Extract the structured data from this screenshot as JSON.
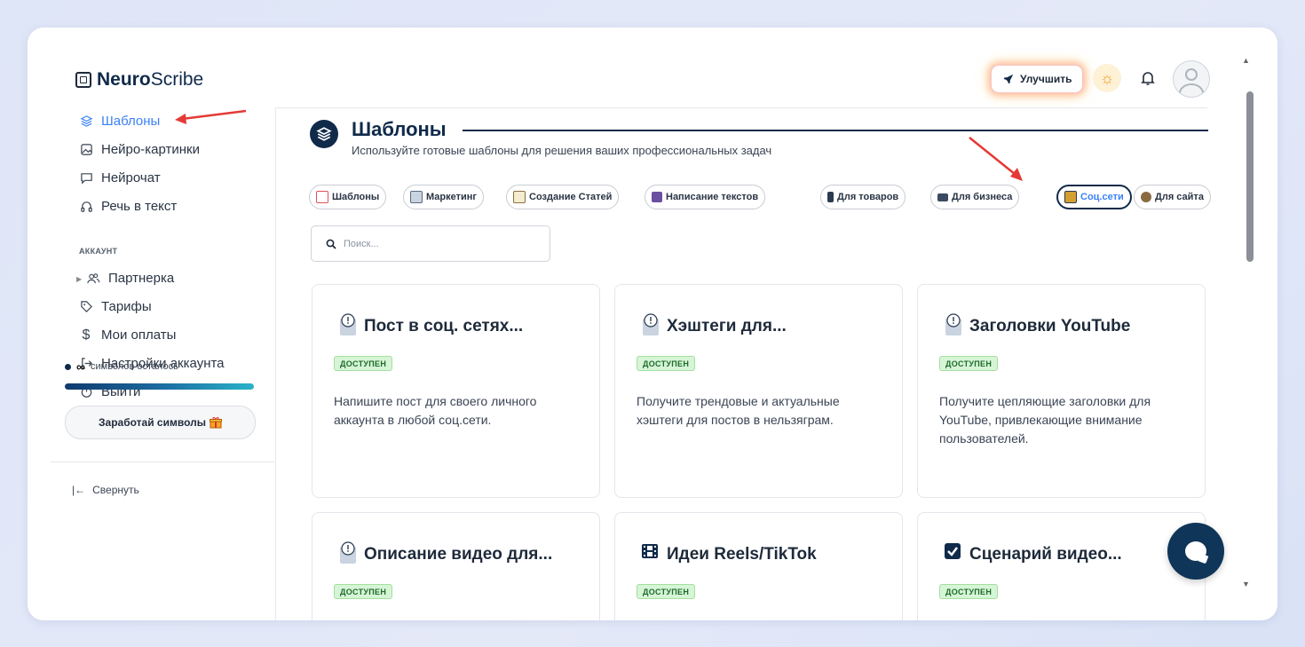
{
  "app": {
    "logo_bold": "Neuro",
    "logo_regular": "Scribe"
  },
  "header": {
    "upgrade_label": "Улучшить",
    "theme_icon": "sun-icon",
    "notifications_icon": "bell-icon",
    "avatar_icon": "user-avatar-icon"
  },
  "sidebar": {
    "items": [
      {
        "label": "Шаблоны",
        "icon": "layers-icon",
        "active": true
      },
      {
        "label": "Нейро-картинки",
        "icon": "image-icon"
      },
      {
        "label": "Нейрочат",
        "icon": "chat-icon"
      },
      {
        "label": "Речь в текст",
        "icon": "headphones-icon"
      }
    ],
    "account_label": "АККАУНТ",
    "account_items": [
      {
        "label": "Партнерка",
        "icon": "users-icon"
      },
      {
        "label": "Тарифы",
        "icon": "tag-icon"
      },
      {
        "label": "Мои оплаты",
        "icon": "dollar-icon"
      },
      {
        "label": "Настройки аккаунта",
        "icon": "login-icon"
      },
      {
        "label": "Выйти",
        "icon": "power-icon"
      }
    ],
    "chars_infinity": "∞",
    "chars_label": "символов осталось",
    "earn_label": "Заработай символы",
    "collapse_label": "Свернуть"
  },
  "main": {
    "title": "Шаблоны",
    "subtitle": "Используйте готовые шаблоны для решения ваших профессиональных задач",
    "search_placeholder": "Поиск...",
    "chips": [
      {
        "label": "Шаблоны",
        "color": "#e0505a"
      },
      {
        "label": "Маркетинг",
        "color": "#8aa0b8"
      },
      {
        "label": "Создание Статей",
        "color": "#c8b070"
      },
      {
        "label": "Написание текстов",
        "color": "#6b4fa0"
      },
      {
        "label": "Для товаров",
        "color": "#2a3a50"
      },
      {
        "label": "Для бизнеса",
        "color": "#3a4a60"
      },
      {
        "label": "Соц.сети",
        "color": "#d4a030",
        "active": true
      },
      {
        "label": "Для сайта",
        "color": "#6a5030"
      }
    ],
    "cards": [
      {
        "title": "Пост в соц. сетях...",
        "badge": "ДОСТУПЕН",
        "desc": "Напишите пост для своего личного аккаунта в любой соц.сети.",
        "icon": "clipboard-alert-icon"
      },
      {
        "title": "Хэштеги для...",
        "badge": "ДОСТУПЕН",
        "desc": "Получите трендовые и актуальные хэштеги для постов в нельзяграм.",
        "icon": "clipboard-alert-icon"
      },
      {
        "title": "Заголовки YouTube",
        "badge": "ДОСТУПЕН",
        "desc": "Получите цепляющие заголовки для YouTube, привлекающие внимание пользователей.",
        "icon": "clipboard-alert-icon"
      },
      {
        "title": "Описание видео для...",
        "badge": "ДОСТУПЕН",
        "desc": "",
        "icon": "clipboard-alert-icon"
      },
      {
        "title": "Идеи Reels/TikTok",
        "badge": "ДОСТУПЕН",
        "desc": "",
        "icon": "film-icon"
      },
      {
        "title": "Сценарий видео...",
        "badge": "ДОСТУПЕН",
        "desc": "",
        "icon": "checkbox-icon"
      }
    ]
  },
  "colors": {
    "brand_dark": "#102a4a",
    "accent_blue": "#3b82f6",
    "arrow_red": "#e53935"
  }
}
